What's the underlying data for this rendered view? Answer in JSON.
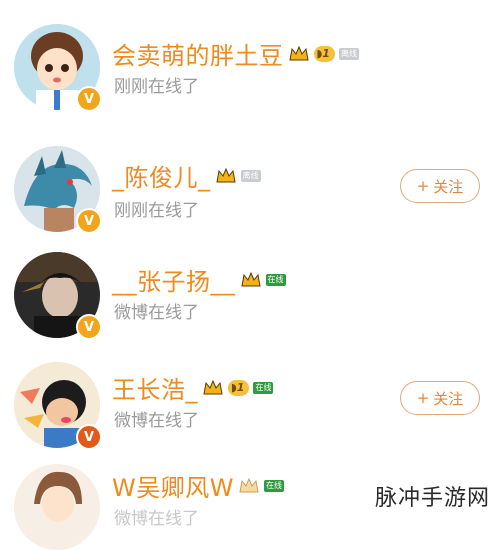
{
  "users": [
    {
      "name": "会卖萌的胖土豆",
      "status": "刚刚在线了",
      "level": "1",
      "tag": "离线",
      "verified": "V",
      "follow": ""
    },
    {
      "name": "_陈俊儿_",
      "status": "刚刚在线了",
      "level": "",
      "tag": "离线",
      "verified": "V",
      "follow": "关注"
    },
    {
      "name": "__张子扬__",
      "status": "微博在线了",
      "level": "",
      "tag": "在线",
      "verified": "V",
      "follow": ""
    },
    {
      "name": "王长浩_",
      "status": "微博在线了",
      "level": "1",
      "tag": "在线",
      "verified": "V",
      "follow": "关注"
    },
    {
      "name": "W吴卿风W",
      "status": "微博在线了",
      "level": "",
      "tag": "在线",
      "verified": "",
      "follow": ""
    }
  ],
  "follow_plus": "+",
  "watermark": "脉冲手游网",
  "colors": {
    "name": "#f08a1c",
    "status": "#9a9a9a",
    "online_tag": "#2e9b3e",
    "badge": "#f2a51a"
  }
}
